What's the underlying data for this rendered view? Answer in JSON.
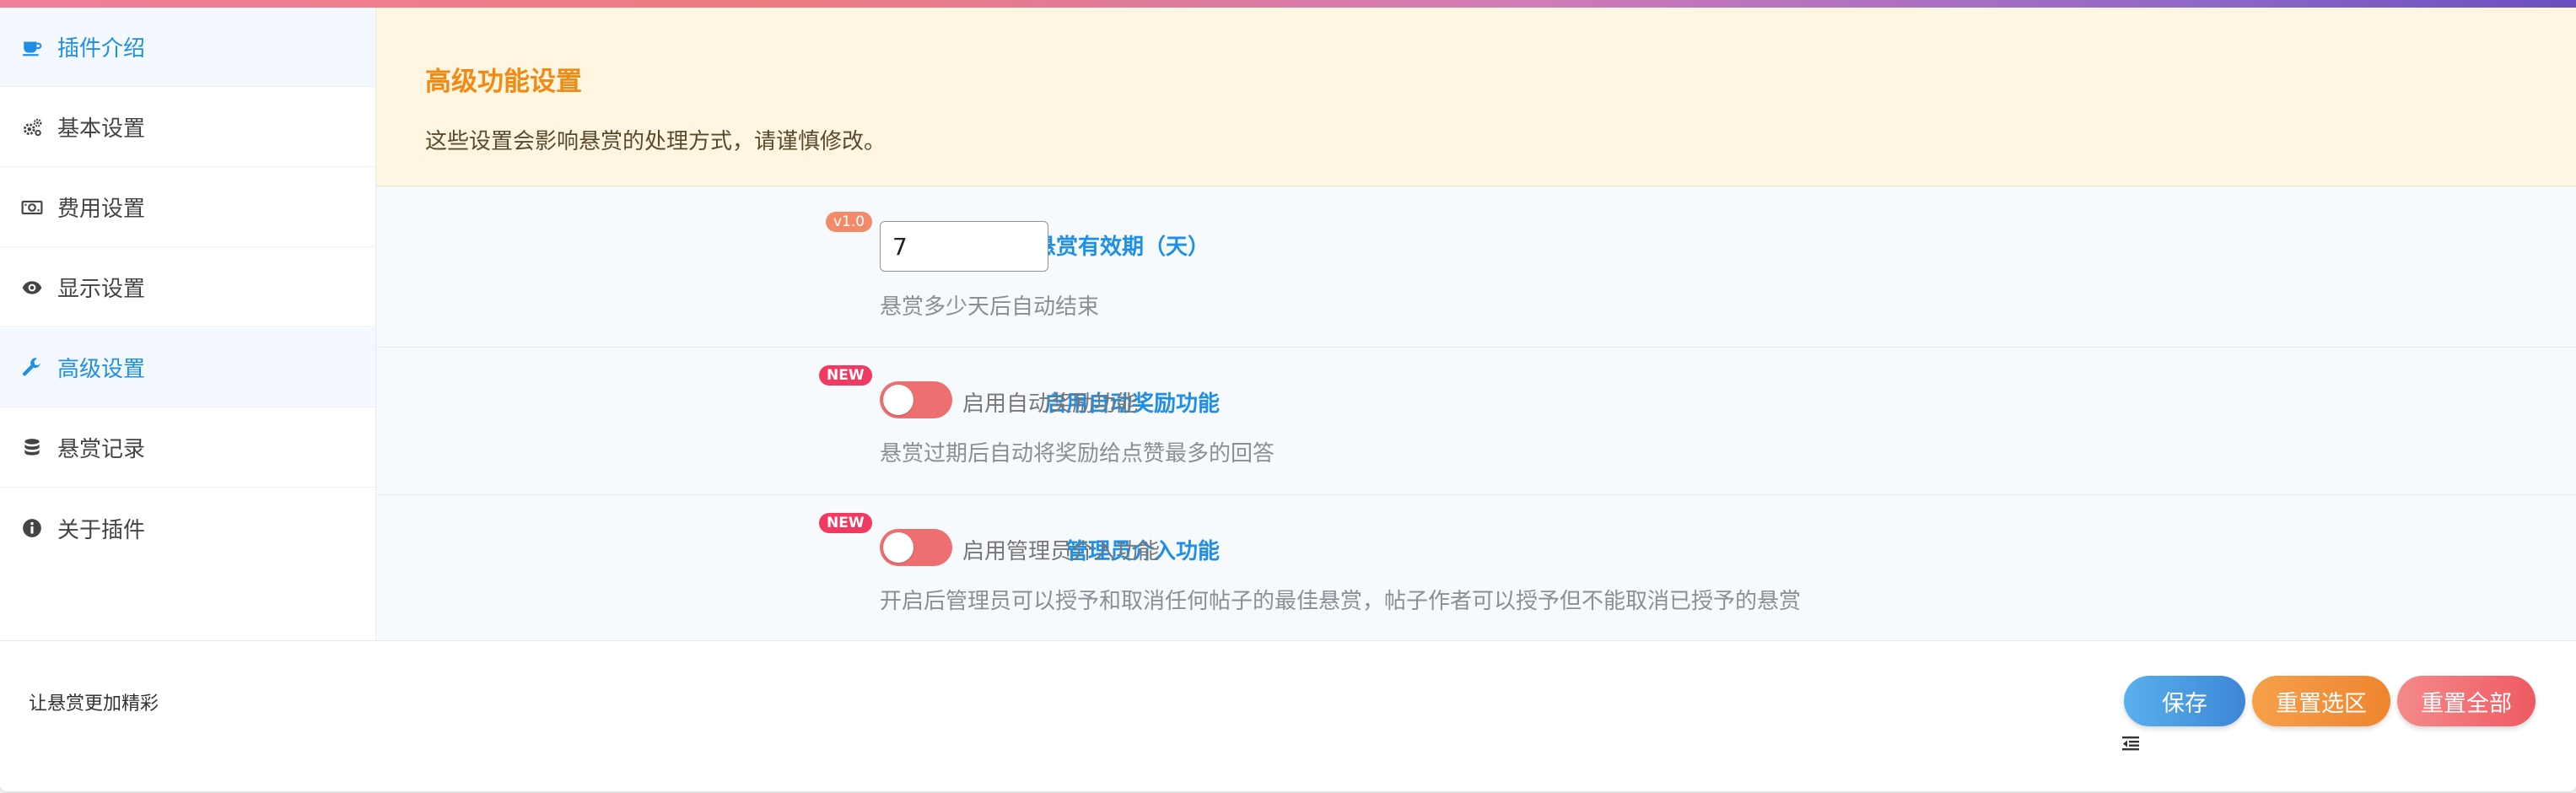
{
  "sidebar": {
    "items": [
      {
        "label": "插件介绍",
        "icon": "coffee-icon"
      },
      {
        "label": "基本设置",
        "icon": "cogs-icon"
      },
      {
        "label": "费用设置",
        "icon": "money-icon"
      },
      {
        "label": "显示设置",
        "icon": "eye-icon"
      },
      {
        "label": "高级设置",
        "icon": "wrench-icon",
        "active": true
      },
      {
        "label": "悬赏记录",
        "icon": "database-icon"
      },
      {
        "label": "关于插件",
        "icon": "info-icon"
      }
    ]
  },
  "notice": {
    "title": "高级功能设置",
    "text": "这些设置会影响悬赏的处理方式，请谨慎修改。"
  },
  "fields": {
    "expiry": {
      "label": "悬赏有效期（天）",
      "tag": "v1.0",
      "value": "7",
      "description": "悬赏多少天后自动结束"
    },
    "auto_reward": {
      "label": "启用自动奖励功能",
      "tag": "NEW",
      "toggle_label": "启用自动奖励功能",
      "enabled": false,
      "description": "悬赏过期后自动将奖励给点赞最多的回答"
    },
    "admin_intervene": {
      "label": "管理员介入功能",
      "tag": "NEW",
      "toggle_label": "启用管理员介入功能",
      "enabled": false,
      "description": "开启后管理员可以授予和取消任何帖子的最佳悬赏，帖子作者可以授予但不能取消已授予的悬赏"
    }
  },
  "footer": {
    "text": "让悬赏更加精彩",
    "save_label": "保存",
    "reset_section_label": "重置选区",
    "reset_all_label": "重置全部"
  },
  "colors": {
    "accent": "#1e8ee6",
    "notice_title": "#f08a12",
    "toggle_off": "#ee6f6f",
    "tag_new": "#f03a62",
    "tag_version": "#f28b6a"
  }
}
